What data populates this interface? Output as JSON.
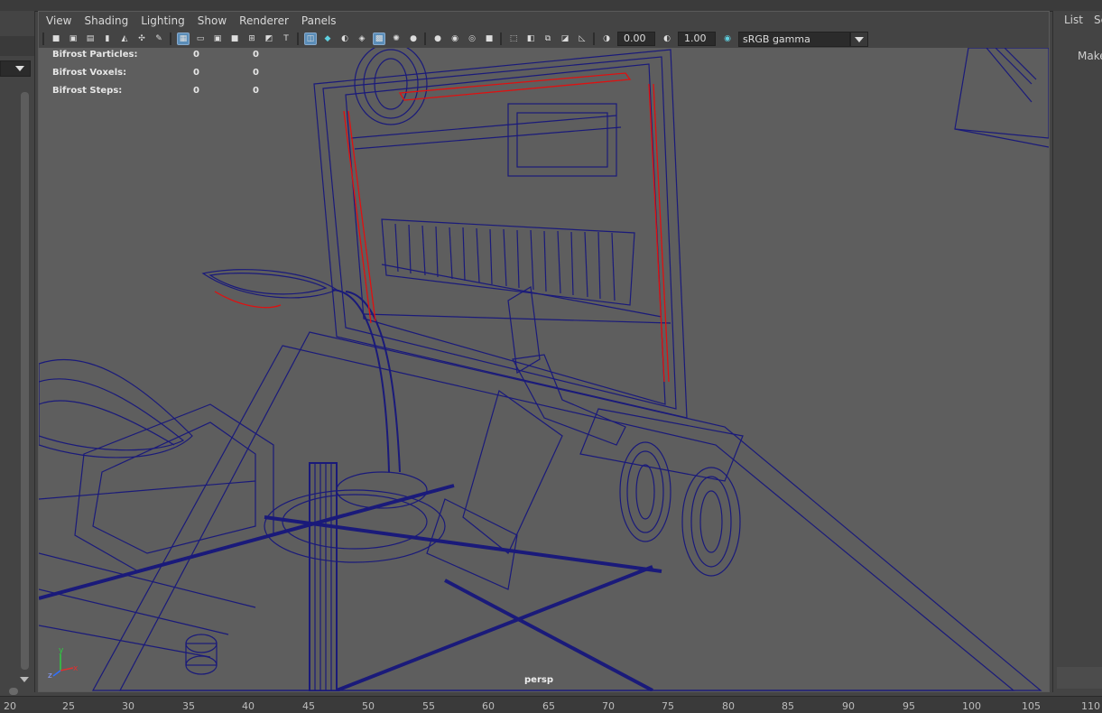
{
  "viewport_menu": [
    "View",
    "Shading",
    "Lighting",
    "Show",
    "Renderer",
    "Panels"
  ],
  "toolbar": {
    "exposure": "0.00",
    "gamma": "1.00",
    "color_space": "sRGB gamma"
  },
  "hud": [
    {
      "label": "Bifrost Particles:",
      "v1": "0",
      "v2": "0"
    },
    {
      "label": "Bifrost Voxels:",
      "v1": "0",
      "v2": "0"
    },
    {
      "label": "Bifrost Steps:",
      "v1": "0",
      "v2": "0"
    }
  ],
  "camera_label": "persp",
  "axis": {
    "x": "x",
    "y": "y",
    "z": "z"
  },
  "right_panel": {
    "list": "List",
    "se": "Se",
    "make": "Make"
  },
  "timeline_ticks": [
    "20",
    "25",
    "30",
    "35",
    "40",
    "45",
    "50",
    "55",
    "60",
    "65",
    "70",
    "75",
    "80",
    "85",
    "90",
    "95",
    "100",
    "105",
    "110"
  ],
  "colors": {
    "wire": "#1a1a7a",
    "highlight": "#e01010",
    "viewport_bg": "#5e5e5e"
  }
}
